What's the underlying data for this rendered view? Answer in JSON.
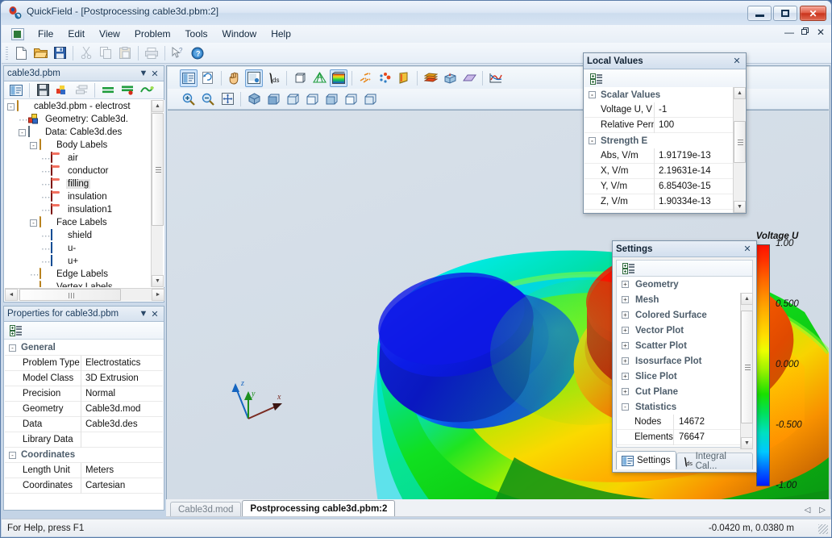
{
  "window": {
    "title": "QuickField - [Postprocessing cable3d.pbm:2]",
    "app_icon": "quickfield-logo-icon",
    "minimize_label": "Minimize",
    "maximize_label": "Restore",
    "close_label": "Close",
    "mdi_minimize": "—",
    "mdi_restore": "❐",
    "mdi_close": "✕"
  },
  "menu": {
    "items": [
      "File",
      "Edit",
      "View",
      "Problem",
      "Tools",
      "Window",
      "Help"
    ]
  },
  "main_toolbar": {
    "buttons": [
      {
        "name": "new-icon",
        "label": "New"
      },
      {
        "name": "open-icon",
        "label": "Open"
      },
      {
        "name": "save-icon",
        "label": "Save"
      },
      {
        "name": "cut-icon",
        "label": "Cut"
      },
      {
        "name": "copy-icon",
        "label": "Copy"
      },
      {
        "name": "paste-icon",
        "label": "Paste"
      },
      {
        "name": "print-icon",
        "label": "Print"
      },
      {
        "name": "context-help-icon",
        "label": "What's This Help"
      },
      {
        "name": "help-icon",
        "label": "Help"
      }
    ]
  },
  "view_toolbar_row1": {
    "buttons": [
      {
        "name": "problem-window-icon",
        "label": "Problem Window",
        "active": true
      },
      {
        "name": "refresh-icon",
        "label": "Refresh"
      },
      {
        "name": "pan-hand-icon",
        "label": "Pan"
      },
      {
        "name": "local-values-icon",
        "label": "Local Values",
        "active": true
      },
      {
        "name": "integral-calculator-icon",
        "label": "Integral Calculator"
      },
      {
        "name": "geometry-icon",
        "label": "Geometry"
      },
      {
        "name": "mesh-icon",
        "label": "Mesh"
      },
      {
        "name": "colored-surface-icon",
        "label": "Colored Surface",
        "active": true
      },
      {
        "name": "vector-plot-icon",
        "label": "Vector Plot"
      },
      {
        "name": "scatter-plot-icon",
        "label": "Scatter Plot"
      },
      {
        "name": "isosurface-plot-icon",
        "label": "Isosurface Plot"
      },
      {
        "name": "slice-plot-icon",
        "label": "Slice Plot"
      },
      {
        "name": "cut-plane-icon",
        "label": "Cut Plane"
      },
      {
        "name": "plane-icon",
        "label": "Plane"
      },
      {
        "name": "xy-plot-icon",
        "label": "XY Plot"
      }
    ]
  },
  "view_toolbar_row2": {
    "buttons": [
      {
        "name": "zoom-in-icon",
        "label": "Zoom In"
      },
      {
        "name": "zoom-out-icon",
        "label": "Zoom Out"
      },
      {
        "name": "zoom-fit-icon",
        "label": "Fit to Window"
      },
      {
        "name": "view-isometric-icon",
        "label": "Isometric View"
      },
      {
        "name": "view-front-icon",
        "label": "Front View"
      },
      {
        "name": "view-back-icon",
        "label": "Back View"
      },
      {
        "name": "view-left-icon",
        "label": "Left View"
      },
      {
        "name": "view-right-icon",
        "label": "Right View"
      },
      {
        "name": "view-top-icon",
        "label": "Top View"
      },
      {
        "name": "view-bottom-icon",
        "label": "Bottom View"
      }
    ]
  },
  "tree_panel": {
    "title": "cable3d.pbm",
    "dropdown_glyph": "▼",
    "close_glyph": "✕",
    "toolbar": [
      {
        "name": "open-problem-icon",
        "label": "Open Problem"
      },
      {
        "name": "save-problem-icon",
        "label": "Save Problem"
      },
      {
        "name": "edit-geometry-icon",
        "label": "Edit Geometry"
      },
      {
        "name": "edit-data-icon",
        "label": "Edit Data"
      },
      {
        "name": "solve-icon",
        "label": "Solve"
      },
      {
        "name": "solve-stop-icon",
        "label": "Stop Solve"
      },
      {
        "name": "analyze-results-icon",
        "label": "Analyze Results"
      }
    ],
    "nodes": [
      {
        "label": "cable3d.pbm - electrost",
        "indent": 0,
        "expander": "-",
        "icon": "folder-open-icon",
        "selected": false
      },
      {
        "label": "Geometry: Cable3d.",
        "indent": 1,
        "expander": "",
        "icon": "geometry-icon",
        "selected": false
      },
      {
        "label": "Data: Cable3d.des",
        "indent": 1,
        "expander": "-",
        "icon": "data-grid-icon",
        "selected": false
      },
      {
        "label": "Body Labels",
        "indent": 2,
        "expander": "-",
        "icon": "folder-open-icon",
        "selected": false
      },
      {
        "label": "air",
        "indent": 3,
        "expander": "",
        "icon": "body-label-icon",
        "selected": false
      },
      {
        "label": "conductor",
        "indent": 3,
        "expander": "",
        "icon": "body-label-icon",
        "selected": false
      },
      {
        "label": "filling",
        "indent": 3,
        "expander": "",
        "icon": "body-label-icon",
        "selected": true
      },
      {
        "label": "insulation",
        "indent": 3,
        "expander": "",
        "icon": "body-label-icon",
        "selected": false
      },
      {
        "label": "insulation1",
        "indent": 3,
        "expander": "",
        "icon": "body-label-icon",
        "selected": false
      },
      {
        "label": "Face Labels",
        "indent": 2,
        "expander": "-",
        "icon": "folder-open-icon",
        "selected": false
      },
      {
        "label": "shield",
        "indent": 3,
        "expander": "",
        "icon": "face-label-icon",
        "selected": false
      },
      {
        "label": "u-",
        "indent": 3,
        "expander": "",
        "icon": "face-label-icon",
        "selected": false
      },
      {
        "label": "u+",
        "indent": 3,
        "expander": "",
        "icon": "face-label-icon",
        "selected": false
      },
      {
        "label": "Edge Labels",
        "indent": 2,
        "expander": "",
        "icon": "folder-icon",
        "selected": false
      },
      {
        "label": "Vertex Labels",
        "indent": 2,
        "expander": "",
        "icon": "folder-icon",
        "selected": false
      }
    ]
  },
  "properties_panel": {
    "title": "Properties for cable3d.pbm",
    "dropdown_glyph": "▼",
    "close_glyph": "✕",
    "toolbar": [
      {
        "name": "categorized-view-icon",
        "label": "Categorized"
      }
    ],
    "groups": [
      {
        "name": "General",
        "expander": "-",
        "rows": [
          {
            "key": "Problem Type",
            "value": "Electrostatics"
          },
          {
            "key": "Model Class",
            "value": "3D Extrusion"
          },
          {
            "key": "Precision",
            "value": "Normal"
          },
          {
            "key": "Geometry",
            "value": "Cable3d.mod"
          },
          {
            "key": "Data",
            "value": "Cable3d.des"
          },
          {
            "key": "Library Data",
            "value": ""
          }
        ]
      },
      {
        "name": "Coordinates",
        "expander": "-",
        "rows": [
          {
            "key": "Length Unit",
            "value": "Meters"
          },
          {
            "key": "Coordinates",
            "value": "Cartesian"
          }
        ]
      }
    ]
  },
  "local_values": {
    "title": "Local Values",
    "close_glyph": "✕",
    "toolbar": [
      {
        "name": "categorized-view-icon",
        "label": "Categorized"
      }
    ],
    "sections": [
      {
        "name": "Scalar Values",
        "expander": "-",
        "rows": [
          {
            "key": "Voltage U, V",
            "value": "-1"
          },
          {
            "key": "Relative Permi",
            "value": "100"
          }
        ]
      },
      {
        "name": "Strength E",
        "expander": "-",
        "rows": [
          {
            "key": "Abs, V/m",
            "value": "1.91719e-13"
          },
          {
            "key": "X, V/m",
            "value": "2.19631e-14"
          },
          {
            "key": "Y, V/m",
            "value": "6.85403e-15"
          },
          {
            "key": "Z, V/m",
            "value": "1.90334e-13"
          }
        ]
      }
    ]
  },
  "settings_panel": {
    "title": "Settings",
    "close_glyph": "✕",
    "toolbar": [
      {
        "name": "categorized-view-icon",
        "label": "Categorized"
      }
    ],
    "items": [
      {
        "label": "Geometry",
        "expander": "+"
      },
      {
        "label": "Mesh",
        "expander": "+"
      },
      {
        "label": "Colored Surface",
        "expander": "+"
      },
      {
        "label": "Vector Plot",
        "expander": "+"
      },
      {
        "label": "Scatter Plot",
        "expander": "+"
      },
      {
        "label": "Isosurface Plot",
        "expander": "+"
      },
      {
        "label": "Slice Plot",
        "expander": "+"
      },
      {
        "label": "Cut Plane",
        "expander": "+"
      },
      {
        "label": "Statistics",
        "expander": "-"
      }
    ],
    "statistics": [
      {
        "key": "Nodes",
        "value": "14672"
      },
      {
        "key": "Elements",
        "value": "76647"
      }
    ],
    "tabs": [
      {
        "label": "Settings",
        "icon": "settings-tab-icon",
        "selected": true
      },
      {
        "label": "Integral Cal...",
        "icon": "integral-tab-icon",
        "selected": false
      }
    ]
  },
  "canvas": {
    "legend": {
      "title": "Voltage U",
      "ticks": [
        {
          "label": "1.00",
          "pos": 0
        },
        {
          "label": "0.500",
          "pos": 25
        },
        {
          "label": "0.000",
          "pos": 50
        },
        {
          "label": "-0.500",
          "pos": 75
        },
        {
          "label": "-1.00",
          "pos": 100
        }
      ],
      "color_top": "#ff1100",
      "color_mid": "#19e000",
      "color_bottom": "#0018ff"
    },
    "axes": [
      {
        "name": "z-axis",
        "label": "z",
        "color": "#1565c0"
      },
      {
        "name": "y-axis",
        "label": "y",
        "color": "#1d8f1d"
      },
      {
        "name": "x-axis",
        "label": "x",
        "color": "#7a2b22"
      }
    ]
  },
  "document_tabs": {
    "tabs": [
      {
        "label": "Cable3d.mod",
        "selected": false
      },
      {
        "label": "Postprocessing cable3d.pbm:2",
        "selected": true
      }
    ],
    "prev_glyph": "◁",
    "next_glyph": "▷"
  },
  "statusbar": {
    "hint": "For Help, press F1",
    "coordinates": "-0.0420 m, 0.0380 m"
  }
}
